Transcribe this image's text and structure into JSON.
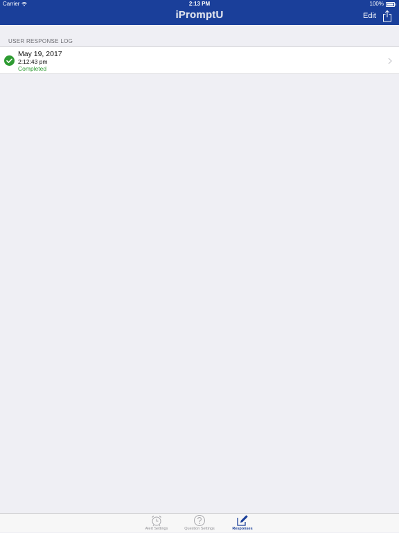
{
  "status_bar": {
    "carrier": "Carrier",
    "time": "2:13 PM",
    "battery": "100%"
  },
  "nav": {
    "brand": "iPromptU",
    "edit_label": "Edit"
  },
  "section": {
    "header": "USER RESPONSE LOG"
  },
  "log": {
    "items": [
      {
        "date": "May 19, 2017",
        "time": "2:12:43 pm",
        "status": "Completed"
      }
    ]
  },
  "tabs": [
    {
      "label": "Alert Settings",
      "icon": "alarm-clock-icon"
    },
    {
      "label": "Question Settings",
      "icon": "question-circle-icon"
    },
    {
      "label": "Responses",
      "icon": "pencil-square-icon",
      "active": true
    }
  ],
  "colors": {
    "header_background": "#1a3f9a",
    "completed_green": "#2e9b32",
    "active_tab": "#1a3f9a"
  }
}
